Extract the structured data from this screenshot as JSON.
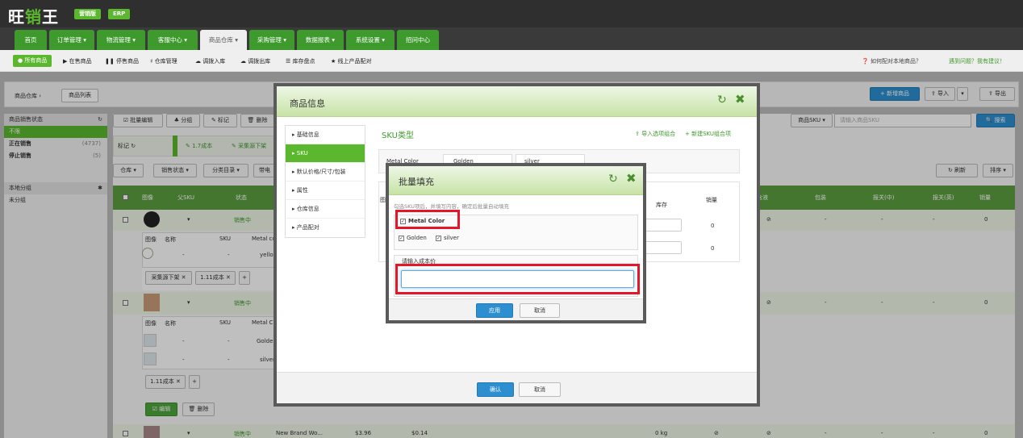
{
  "app": {
    "logo_a": "旺",
    "logo_b": "销",
    "logo_c": "王",
    "edition": "营销版",
    "erp": "ERP"
  },
  "nav": {
    "tabs": [
      "首页",
      "订单管理 ▾",
      "物流管理 ▾",
      "客服中心 ▾",
      "商品仓库 ▾",
      "采购管理 ▾",
      "数据报表 ▾",
      "系统设置 ▾",
      "招问中心"
    ]
  },
  "subnav": {
    "all": "● 所有商品",
    "items": [
      "▶ 在售商品",
      "❚❚ 停售商品",
      "♯ 仓库管理",
      "☁ 调拨入库",
      "☁ 调拨出库",
      "☰ 库存盘点",
      "★ 线上产品配对"
    ],
    "help1": "❓ 如何配对本地商品？",
    "help2": "遇到问题？我有建议！"
  },
  "crumb": {
    "a": "商品仓库 ›",
    "b": "商品列表",
    "add": "+ 新增商品",
    "import": "⇪ 导入",
    "export": "⇪ 导出"
  },
  "sidebar": {
    "head1": "商品销售状态",
    "rows": [
      {
        "label": "不限",
        "count": ""
      },
      {
        "label": "正在销售",
        "count": "(4737)"
      },
      {
        "label": "停止销售",
        "count": "(5)"
      }
    ],
    "head2": "本地分组",
    "ungrouped": "未分组"
  },
  "toolbar": {
    "batch_edit": "☑ 批量编辑",
    "group": "♣ 分组",
    "mark": "✎ 标记",
    "delete": "🗑 删除",
    "mark_label": "标记 ↻",
    "tag1": "✎ 1.7成本",
    "tag2": "✎ 采集源下架",
    "f_warehouse": "仓库 ▾",
    "f_status": "销售状态 ▾",
    "f_category": "分类目录 ▾",
    "f_bring": "带电",
    "sku_select": "商品SKU ▾",
    "sku_placeholder": "请输入商品SKU",
    "search": "🔍 搜索",
    "refresh": "↻ 刷新",
    "sort": "排序 ▾"
  },
  "table": {
    "headers": [
      "图像",
      "父SKU",
      "状态",
      "含液",
      "包装",
      "报关(中)",
      "报关(英)",
      "销量"
    ],
    "rows": [
      {
        "status": "销售中",
        "hanye": "⊘",
        "pack": "-",
        "zh": "-",
        "en": "-",
        "sales": "0"
      },
      {
        "status": "销售中",
        "hanye": "⊘",
        "pack": "-",
        "zh": "-",
        "en": "-",
        "sales": "0"
      },
      {
        "status": "销售中",
        "name": "New Brand Wo...",
        "p1": "$3.96",
        "p2": "$0.14",
        "weight": "0 kg",
        "hanye0": "⊘",
        "hanye": "⊘",
        "pack": "-",
        "zh": "-",
        "en": "-",
        "sales": "0"
      }
    ],
    "sub_headers": [
      "图像",
      "名称",
      "SKU",
      "Metal co"
    ],
    "sub_headers_b": [
      "图像",
      "名称",
      "SKU",
      "Metal C"
    ],
    "dash": "-",
    "yellow": "yellow",
    "golden": "Golden",
    "silver": "silver",
    "tagA": "采集源下架 ✕",
    "tagB": "1.11成本 ✕",
    "tagC": "1.11成本 ✕",
    "plus": "+",
    "edit": "☑ 编辑",
    "del": "🗑 删除"
  },
  "modal1": {
    "title": "商品信息",
    "nav": [
      "基础信息",
      "SKU",
      "默认价格/尺寸/包装",
      "属性",
      "仓库信息",
      "产品配对"
    ],
    "sku_title": "SKU类型",
    "import_combo": "⇪ 导入选项组合",
    "new_combo": "+ 新建SKU组合项",
    "metal_label": "Metal Color",
    "golden": "Golden",
    "silver": "silver",
    "col_image": "图像",
    "col_stock": "库存",
    "col_sales": "销量",
    "zero1": "0",
    "zero2": "0",
    "confirm": "确认",
    "cancel": "取消"
  },
  "modal2": {
    "title": "批量填充",
    "hint": "勾选SKU项后，并填写内容，确定后批量自动填充",
    "metal": "Metal Color",
    "golden": "Golden",
    "silver": "silver",
    "input_label": "请输入成本价",
    "apply": "应用",
    "cancel": "取消"
  },
  "colors": {
    "green": "#5bb82e",
    "red": "#e5162a",
    "blue": "#2d8fd0"
  }
}
